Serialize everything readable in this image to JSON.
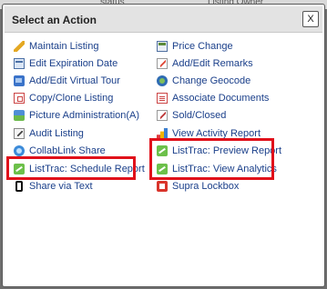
{
  "background": {
    "text_left": "status",
    "text_right": "Listing Owner"
  },
  "dialog": {
    "title": "Select an Action",
    "close_label": "X"
  },
  "left_actions": [
    {
      "label": "Maintain Listing",
      "icon": "pencil-icon"
    },
    {
      "label": "Edit Expiration Date",
      "icon": "calendar-icon"
    },
    {
      "label": "Add/Edit Virtual Tour",
      "icon": "virtual-tour-icon"
    },
    {
      "label": "Copy/Clone Listing",
      "icon": "copy-icon"
    },
    {
      "label": "Picture Administration(A)",
      "icon": "picture-icon"
    },
    {
      "label": "Audit Listing",
      "icon": "audit-icon"
    },
    {
      "label": "CollabLink Share",
      "icon": "collablink-icon"
    },
    {
      "label": "ListTrac: Schedule Report",
      "icon": "listtrac-icon"
    },
    {
      "label": "Share via Text",
      "icon": "phone-icon"
    }
  ],
  "right_actions": [
    {
      "label": "Price Change",
      "icon": "price-icon"
    },
    {
      "label": "Add/Edit Remarks",
      "icon": "remarks-icon"
    },
    {
      "label": "Change Geocode",
      "icon": "geocode-icon"
    },
    {
      "label": "Associate Documents",
      "icon": "documents-icon"
    },
    {
      "label": "Sold/Closed",
      "icon": "sold-icon"
    },
    {
      "label": "View Activity Report",
      "icon": "activity-report-icon"
    },
    {
      "label": "ListTrac: Preview Report",
      "icon": "listtrac-icon"
    },
    {
      "label": "ListTrac: View Analytics",
      "icon": "listtrac-icon"
    },
    {
      "label": "Supra Lockbox",
      "icon": "lockbox-icon"
    }
  ],
  "colors": {
    "link": "#1a3f8a",
    "highlight": "#e0101a",
    "overlay": "#6f6f6f",
    "header_bg": "#e3e3e3"
  }
}
